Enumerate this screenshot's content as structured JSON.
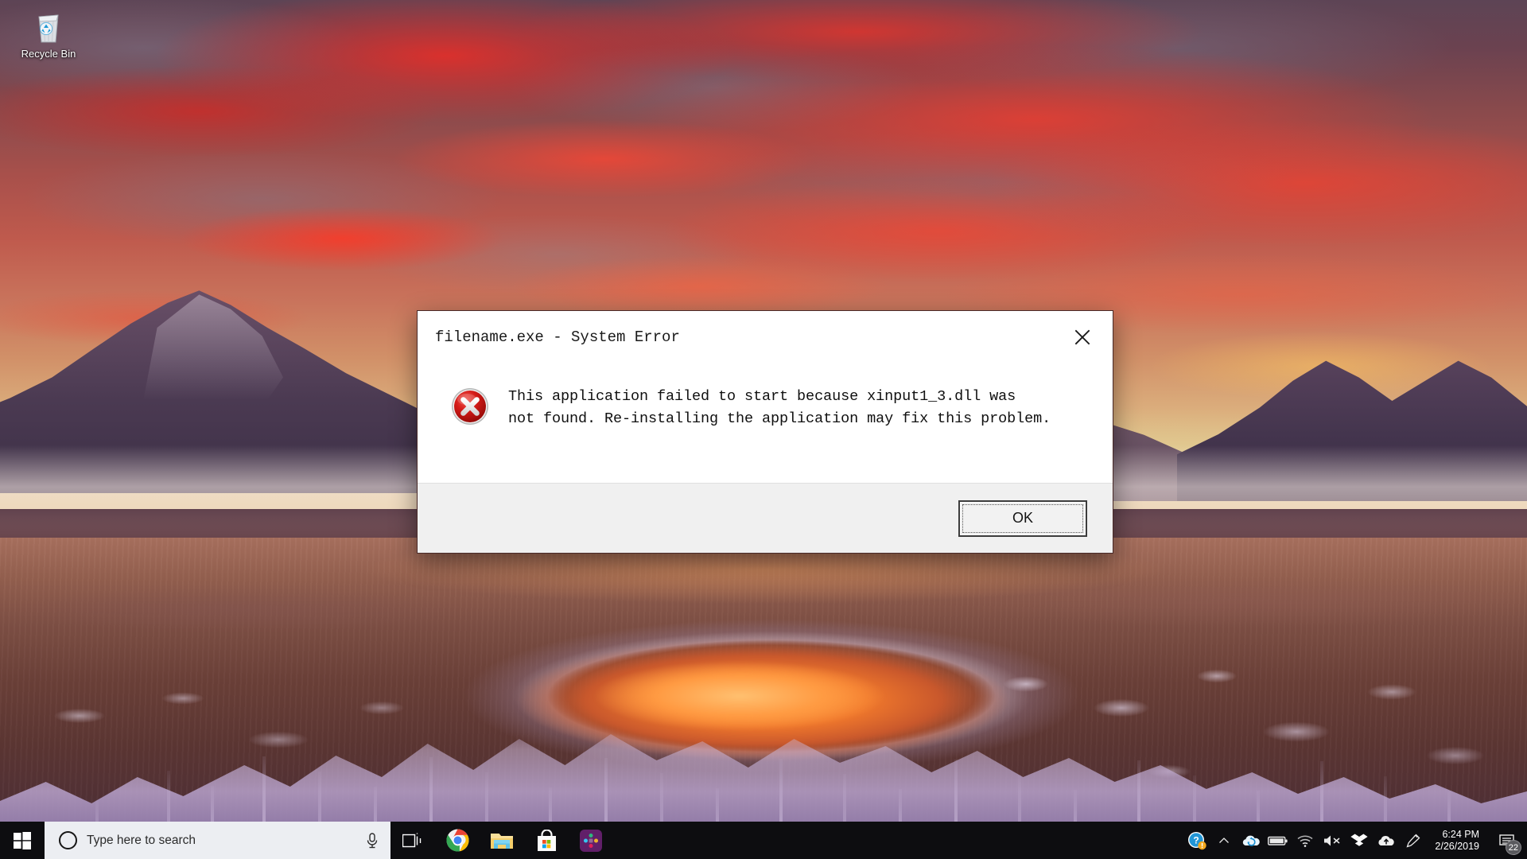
{
  "desktop": {
    "recycle_bin_label": "Recycle Bin",
    "recycle_bin_icon": "recycle-bin-icon",
    "wallpaper_colors": {
      "sky_red": "#e82e28",
      "sky_gray": "#78687a",
      "horizon_yellow": "#ffce46",
      "pool_orange": "#ff9d3f",
      "ground_brown": "#6b4038",
      "ice_lavender": "#cabcd8"
    }
  },
  "dialog": {
    "title": "filename.exe - System Error",
    "close_icon": "close-icon",
    "error_icon": "error-circle-icon",
    "message": "This application failed to start because xinput1_3.dll was\nnot found. Re-installing the application may fix this problem.",
    "ok_label": "OK",
    "error_icon_color": "#cc0000",
    "footer_color": "#f0f0f0"
  },
  "taskbar": {
    "start_icon": "windows-start-icon",
    "search": {
      "placeholder": "Type here to search",
      "value": "",
      "cortana_icon": "cortana-circle-icon",
      "mic_icon": "microphone-icon"
    },
    "pinned": [
      {
        "name": "task-view",
        "icon": "task-view-icon",
        "label": "Task View"
      },
      {
        "name": "chrome",
        "icon": "chrome-icon",
        "label": "Google Chrome"
      },
      {
        "name": "file-explorer",
        "icon": "file-explorer-icon",
        "label": "File Explorer"
      },
      {
        "name": "microsoft-store",
        "icon": "microsoft-store-icon",
        "label": "Microsoft Store"
      },
      {
        "name": "slack",
        "icon": "slack-icon",
        "label": "Slack"
      }
    ],
    "tray": [
      {
        "name": "help-warning",
        "icon": "help-question-warning-icon",
        "label": "Get Help"
      },
      {
        "name": "show-hidden",
        "icon": "chevron-up-icon",
        "label": "Show hidden icons"
      },
      {
        "name": "onedrive",
        "icon": "onedrive-sync-icon",
        "label": "OneDrive"
      },
      {
        "name": "battery",
        "icon": "battery-icon",
        "label": "Battery"
      },
      {
        "name": "network",
        "icon": "wifi-icon",
        "label": "Network"
      },
      {
        "name": "volume",
        "icon": "speaker-muted-icon",
        "label": "Volume muted"
      },
      {
        "name": "dropbox",
        "icon": "dropbox-icon",
        "label": "Dropbox"
      },
      {
        "name": "cloud-upload",
        "icon": "cloud-upload-icon",
        "label": "Cloud"
      },
      {
        "name": "pen-flick",
        "icon": "pen-flick-icon",
        "label": "Pen"
      }
    ],
    "clock": {
      "time": "6:24 PM",
      "date": "2/26/2019"
    },
    "notifications": {
      "icon": "notification-icon",
      "count": "22"
    }
  }
}
